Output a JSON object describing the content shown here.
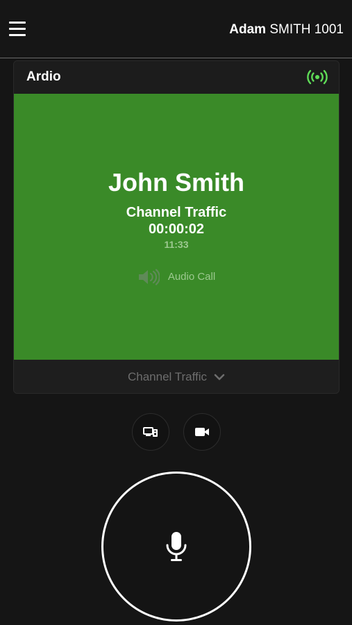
{
  "header": {
    "user_first_name": "Adam",
    "user_last_name_id": "SMITH 1001",
    "menu_icon": "hamburger-menu-icon"
  },
  "card": {
    "title": "Ardio",
    "status_icon": "broadcast-signal-icon",
    "status_color": "#5fdc57"
  },
  "call": {
    "caller_name": "John Smith",
    "channel": "Channel Traffic",
    "duration": "00:00:02",
    "time": "11:33",
    "type_label": "Audio Call",
    "type_icon": "speaker-icon",
    "panel_color": "#3a8a28"
  },
  "channel_selector": {
    "label": "Channel Traffic",
    "icon": "chevron-down-icon"
  },
  "controls": {
    "screen_share_icon": "screen-share-icon",
    "video_icon": "video-camera-icon",
    "ptt_icon": "microphone-icon"
  }
}
